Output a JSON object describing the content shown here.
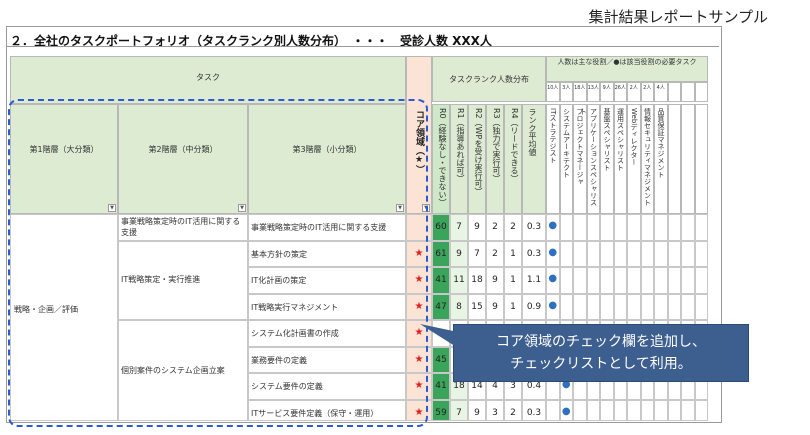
{
  "caption": "集計結果レポートサンプル",
  "title": "２．全社のタスクポートフォリオ（タスクランク別人数分布）　・・・　受診人数 XXX人",
  "headers": {
    "task": "タスク",
    "level1": "第1階層（大分類）",
    "level2": "第2階層（中分類）",
    "level3": "第3階層（小分類）",
    "core": "コア領域（★）",
    "rank_group": "タスクランク人数分布",
    "role_group": "人数は主な役割／●は該当役割の必要タスク",
    "ranks": [
      "R0（経験なし・できない）",
      "R1（指導あれば可）",
      "R2（WPを受け実行可）",
      "R3（独力で実行可）",
      "R4（リードできる）",
      "ランク平均値"
    ],
    "roles": [
      {
        "count": "10人",
        "name": "ITストラテジスト"
      },
      {
        "count": "3人",
        "name": "システムアーキテクト"
      },
      {
        "count": "18人",
        "name": "プロジェクトマネージャ"
      },
      {
        "count": "13人",
        "name": "アプリケーションスペシャリスト"
      },
      {
        "count": "9人",
        "name": "基盤スペシャリスト"
      },
      {
        "count": "26人",
        "name": "運用スペシャリスト"
      },
      {
        "count": "2人",
        "name": "Webディレクター"
      },
      {
        "count": "2人",
        "name": "情報セキュリティマネジメント"
      },
      {
        "count": "4人",
        "name": "品質保証マネジメント"
      },
      {
        "count": "",
        "name": ""
      },
      {
        "count": "",
        "name": ""
      },
      {
        "count": "",
        "name": ""
      }
    ]
  },
  "level1_value": "戦略・企画／評価",
  "level2_values": [
    "事業戦略策定時のIT活用に関する支援",
    "IT戦略策定・実行推進",
    "個別案件のシステム企画立案"
  ],
  "rows": [
    {
      "l3": "事業戦略策定時のIT活用に関する支援",
      "core": "",
      "r0": "60",
      "r1": "7",
      "r2": "9",
      "r3": "2",
      "r4": "2",
      "avg": "0.3",
      "dot": 0
    },
    {
      "l3": "基本方針の策定",
      "core": "★",
      "r0": "61",
      "r1": "9",
      "r2": "7",
      "r3": "2",
      "r4": "1",
      "avg": "0.3",
      "dot": 0
    },
    {
      "l3": "IT化計画の策定",
      "core": "★",
      "r0": "41",
      "r1": "11",
      "r2": "18",
      "r3": "9",
      "r4": "1",
      "avg": "1.1",
      "dot": 0
    },
    {
      "l3": "IT戦略実行マネジメント",
      "core": "★",
      "r0": "47",
      "r1": "8",
      "r2": "15",
      "r3": "9",
      "r4": "1",
      "avg": "0.9",
      "dot": 0
    },
    {
      "l3": "システム化計画書の作成",
      "core": "★",
      "r0": "",
      "r1": "",
      "r2": "",
      "r3": "",
      "r4": "",
      "avg": "",
      "dot": -1
    },
    {
      "l3": "業務要件の定義",
      "core": "★",
      "r0": "45",
      "r1": "",
      "r2": "",
      "r3": "",
      "r4": "",
      "avg": "",
      "dot": -1
    },
    {
      "l3": "システム要件の定義",
      "core": "★",
      "r0": "41",
      "r1": "18",
      "r2": "14",
      "r3": "4",
      "r4": "3",
      "avg": "0.4",
      "dot": 1
    },
    {
      "l3": "ITサービス要件定義（保守・運用）",
      "core": "★",
      "r0": "59",
      "r1": "7",
      "r2": "9",
      "r3": "3",
      "r4": "2",
      "avg": "0.3",
      "dot": 1
    }
  ],
  "callout": [
    "コア領域のチェック欄を追加し、",
    "チェックリストとして利用。"
  ],
  "colors": {
    "header": "#dcebd2",
    "core_col": "#fbe3d6",
    "r0_fill": "#3aa55a",
    "r1_fill": "#a8d8a8",
    "star": "#e02020",
    "dot": "#2f6fc0",
    "callout": "#3d5f8f",
    "dash": "#2a5bd0"
  }
}
